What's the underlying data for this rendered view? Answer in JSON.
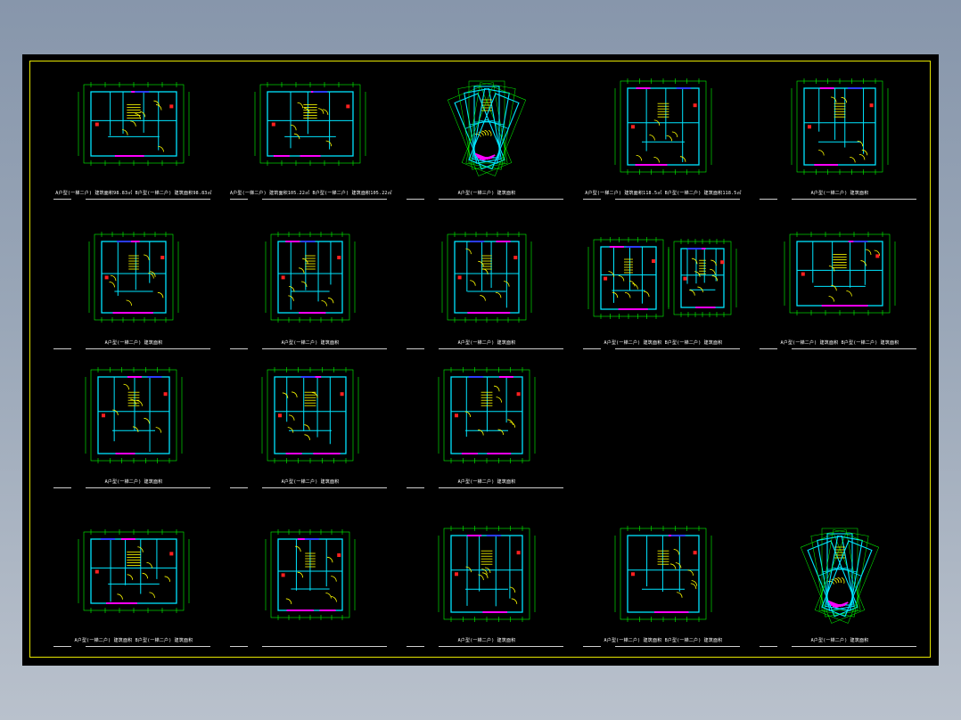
{
  "plans": [
    {
      "id": "p1",
      "row": 0,
      "col": 0,
      "caption": "A户型(一梯二户) 建筑面积98.83㎡  B户型(一梯二户) 建筑面积98.83㎡",
      "variant": "rect-wide"
    },
    {
      "id": "p2",
      "row": 0,
      "col": 1,
      "caption": "A户型(一梯二户) 建筑面积105.22㎡  B户型(一梯二户) 建筑面积105.22㎡",
      "variant": "rect-wide"
    },
    {
      "id": "p3",
      "row": 0,
      "col": 2,
      "caption": "A户型(一梯三户) 建筑面积",
      "variant": "fan"
    },
    {
      "id": "p4",
      "row": 0,
      "col": 3,
      "caption": "A户型(一梯二户) 建筑面积118.5㎡  B户型(一梯二户) 建筑面积118.5㎡",
      "variant": "rect-tall"
    },
    {
      "id": "p5",
      "row": 0,
      "col": 4,
      "caption": "A户型(一梯二户) 建筑面积",
      "variant": "rect-tall"
    },
    {
      "id": "p6",
      "row": 1,
      "col": 0,
      "caption": "A户型(一梯二户) 建筑面积",
      "variant": "square"
    },
    {
      "id": "p7",
      "row": 1,
      "col": 1,
      "caption": "A户型(一梯二户) 建筑面积",
      "variant": "square"
    },
    {
      "id": "p8",
      "row": 1,
      "col": 2,
      "caption": "A户型(一梯二户) 建筑面积",
      "variant": "square"
    },
    {
      "id": "p9",
      "row": 1,
      "col": 3,
      "caption": "A户型(一梯二户) 建筑面积      B户型(一梯二户) 建筑面积",
      "variant": "double"
    },
    {
      "id": "p10",
      "row": 1,
      "col": 4,
      "caption": "A户型(一梯二户) 建筑面积  B户型(一梯二户) 建筑面积",
      "variant": "rect-wide"
    },
    {
      "id": "p11",
      "row": 2,
      "col": 0,
      "caption": "A户型(一梯二户) 建筑面积",
      "variant": "rect-tall"
    },
    {
      "id": "p12",
      "row": 2,
      "col": 1,
      "caption": "A户型(一梯二户) 建筑面积",
      "variant": "rect-tall"
    },
    {
      "id": "p13",
      "row": 2,
      "col": 2,
      "caption": "A户型(一梯二户) 建筑面积",
      "variant": "rect-tall"
    },
    {
      "id": "p14",
      "row": 3,
      "col": 0,
      "caption": "A户型(一梯二户) 建筑面积  B户型(一梯二户) 建筑面积",
      "variant": "rect-wide"
    },
    {
      "id": "p15",
      "row": 3,
      "col": 1,
      "caption": "",
      "variant": "square"
    },
    {
      "id": "p16",
      "row": 3,
      "col": 2,
      "caption": "A户型(一梯二户) 建筑面积",
      "variant": "rect-tall"
    },
    {
      "id": "p17",
      "row": 3,
      "col": 3,
      "caption": "A户型(一梯二户) 建筑面积  B户型(一梯二户) 建筑面积",
      "variant": "rect-tall"
    },
    {
      "id": "p18",
      "row": 3,
      "col": 4,
      "caption": "A户型(一梯二户) 建筑面积",
      "variant": "fan"
    }
  ],
  "colors": {
    "wall": "#00e5ff",
    "dimension": "#00ff00",
    "door": "#ffff00",
    "window": "#ff00ff",
    "stair": "#ffff00",
    "accent_red": "#ff2020",
    "accent_blue": "#2a3cff",
    "text": "#ffffff",
    "frame": "#e6e600"
  }
}
